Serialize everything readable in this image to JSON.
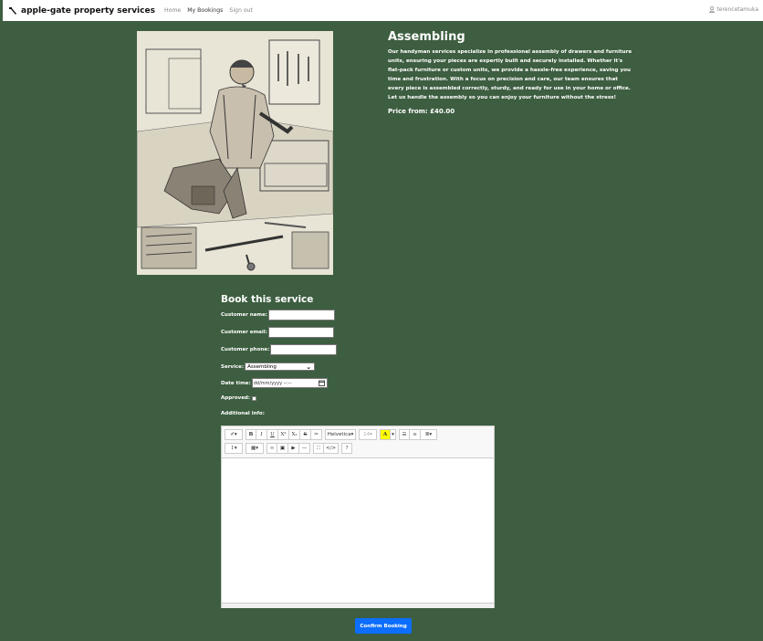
{
  "nav": {
    "brand": "apple-gate property services",
    "links": [
      "Home",
      "My Bookings",
      "Sign out"
    ],
    "user": "terencetamuka"
  },
  "service": {
    "title": "Assembling",
    "description": "Our handyman services specialize in professional assembly of drawers and furniture units, ensuring your pieces are expertly built and securely installed. Whether it's flat-pack furniture or custom units, we provide a hassle-free experience, saving you time and frustration. With a focus on precision and care, our team ensures that every piece is assembled correctly, sturdy, and ready for use in your home or office. Let us handle the assembly so you can enjoy your furniture without the stress!",
    "price": "Price from: £40.00"
  },
  "form": {
    "title": "Book this service",
    "name_label": "Customer name:",
    "email_label": "Customer email:",
    "phone_label": "Customer phone:",
    "service_label": "Service:",
    "service_value": "Assembling",
    "datetime_label": "Date time:",
    "datetime_placeholder": "dd/mm/yyyy --:--",
    "approved_label": "Approved:",
    "additional_label": "Additional info:",
    "toolbar": {
      "font": "Helvetica",
      "size": "14"
    },
    "confirm": "Confirm Booking"
  }
}
